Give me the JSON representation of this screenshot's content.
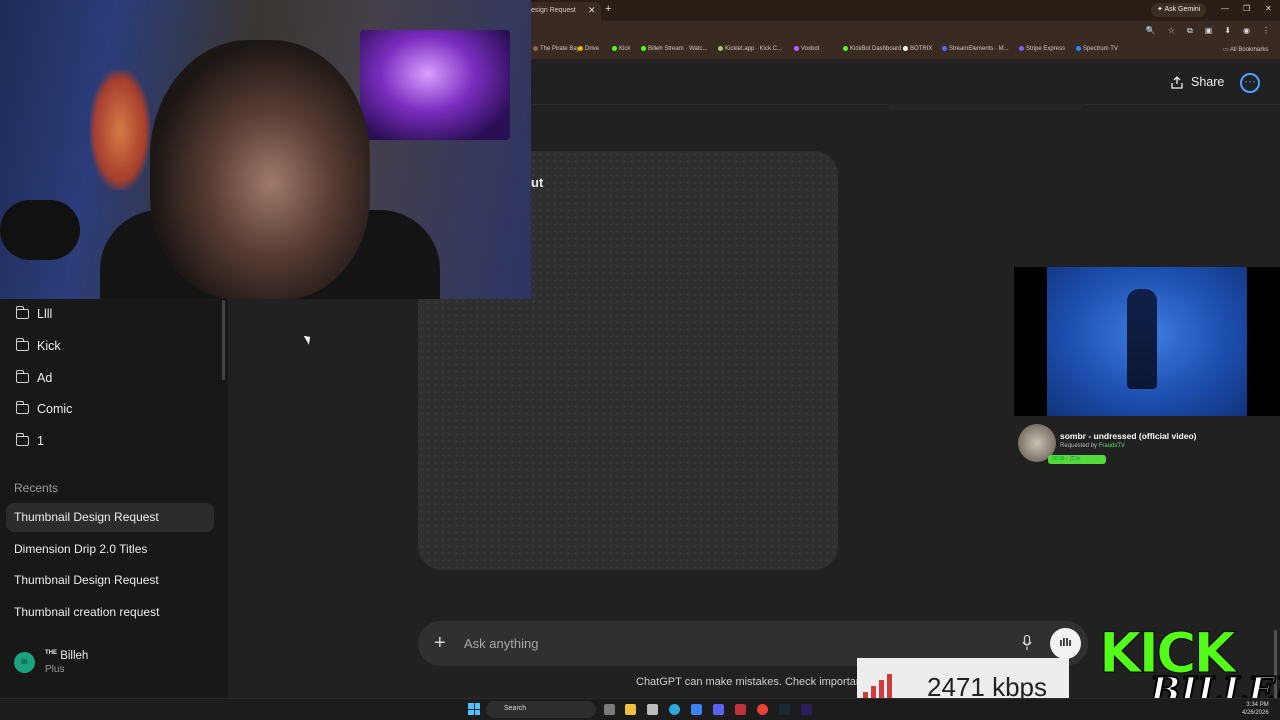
{
  "browser": {
    "tab_title": "esign Request",
    "gemini_label": "Ask Gemini",
    "bookmarks": [
      {
        "label": "The Pirate Bay",
        "color": "#8a6a55"
      },
      {
        "label": "Drive",
        "color": "#f4b400"
      },
      {
        "label": "Kick",
        "color": "#53fc18"
      },
      {
        "label": "Billeh Stream · Watc...",
        "color": "#53fc18"
      },
      {
        "label": "Kicklet.app · Kick C...",
        "color": "#9c6"
      },
      {
        "label": "Voxbot",
        "color": "#c05cff"
      },
      {
        "label": "KickBot Dashboard",
        "color": "#53fc18"
      },
      {
        "label": "BOTRIX",
        "color": "#ffffff"
      },
      {
        "label": "StreamElements · M...",
        "color": "#4a6cff"
      },
      {
        "label": "Stripe Express",
        "color": "#7a5cff"
      },
      {
        "label": "Spectrum TV",
        "color": "#2a8cff"
      }
    ],
    "all_bookmarks": "All Bookmarks"
  },
  "sidebar": {
    "folders": [
      "Llll",
      "Kick",
      "Ad",
      "Comic",
      "1"
    ],
    "recents_label": "Recents",
    "recents": [
      "Thumbnail Design Request",
      "Dimension Drip 2.0 Titles",
      "Thumbnail Design Request",
      "Thumbnail creation request"
    ],
    "user": {
      "initials": "BI",
      "name_prefix": "THE",
      "name": "Billeh",
      "plan": "Plus"
    }
  },
  "header": {
    "share_label": "Share",
    "more_label": "···"
  },
  "main": {
    "card_title_fragment": "ut"
  },
  "composer": {
    "plus": "+",
    "placeholder": "Ask anything",
    "disclaimer": "ChatGPT can make mistakes. Check important ir"
  },
  "music": {
    "title": "sombr - undressed (official video)",
    "requested_prefix": "Requested by",
    "requested_by": "FraudsTV",
    "progress_text": "00:38 · 🎵3x"
  },
  "overlay": {
    "kick_logo": "KICK",
    "billeh_logo": "BILLEH",
    "bitrate": "2471 kbps",
    "bitrate_color": "#d23b3b"
  },
  "taskbar": {
    "search": "Search",
    "time": "3:34 PM",
    "date": "4/26/2026"
  },
  "colors": {
    "accent": "#4da3ff",
    "kick_green": "#53fc18",
    "avatar": "#19a37e"
  }
}
